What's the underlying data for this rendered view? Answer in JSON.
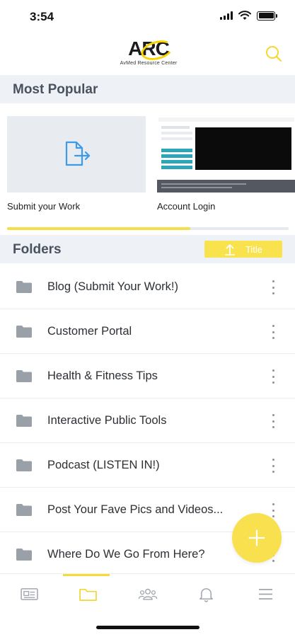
{
  "status_bar": {
    "time": "3:54"
  },
  "header": {
    "logo_text": "ARC",
    "logo_subtitle": "AvMed Resource Center",
    "search_icon": "search-icon"
  },
  "popular": {
    "title": "Most Popular",
    "cards": [
      {
        "label": "Submit your Work",
        "icon": "file-upload-icon"
      },
      {
        "label": "Account Login",
        "icon": "screenshot-thumbnail"
      }
    ],
    "progress": 0.65
  },
  "folders": {
    "title": "Folders",
    "sort_label": "Title",
    "items": [
      {
        "label": "Blog (Submit Your Work!)"
      },
      {
        "label": "Customer Portal"
      },
      {
        "label": "Health & Fitness Tips"
      },
      {
        "label": "Interactive Public Tools"
      },
      {
        "label": "Podcast (LISTEN IN!)"
      },
      {
        "label": "Post Your Fave Pics and Videos..."
      },
      {
        "label": "Where Do We Go From Here?"
      }
    ]
  },
  "nav": {
    "items": [
      {
        "icon": "news-icon"
      },
      {
        "icon": "folder-icon"
      },
      {
        "icon": "people-icon"
      },
      {
        "icon": "bell-icon"
      },
      {
        "icon": "menu-icon"
      }
    ],
    "active_index": 1
  },
  "colors": {
    "accent": "#f6da3a",
    "section_bg": "#eef1f6",
    "icon_gray": "#9aa0a8",
    "upload_blue": "#3d9ae8"
  }
}
